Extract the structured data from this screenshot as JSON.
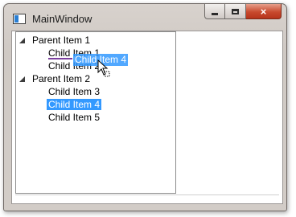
{
  "window": {
    "title": "MainWindow",
    "buttons": {
      "minimize": "minimize",
      "maximize": "maximize",
      "close": "×"
    }
  },
  "tree": {
    "items": [
      {
        "label": "Parent Item 1",
        "expanded": true,
        "children": [
          {
            "label": "Child Item 1"
          },
          {
            "label": "Child Item 2"
          }
        ]
      },
      {
        "label": "Parent Item 2",
        "expanded": true,
        "children": [
          {
            "label": "Child Item 3"
          },
          {
            "label": "Child Item 4",
            "selected": true
          },
          {
            "label": "Child Item 5"
          }
        ]
      }
    ]
  },
  "drag": {
    "ghost_label": "Child Item 4"
  },
  "colors": {
    "selection": "#3399ff",
    "drop_indicator": "#7a3f9e"
  },
  "icons": {
    "app": "window-app-icon",
    "expander": "tree-expander-icon",
    "cursor": "drag-copy-cursor-icon"
  }
}
